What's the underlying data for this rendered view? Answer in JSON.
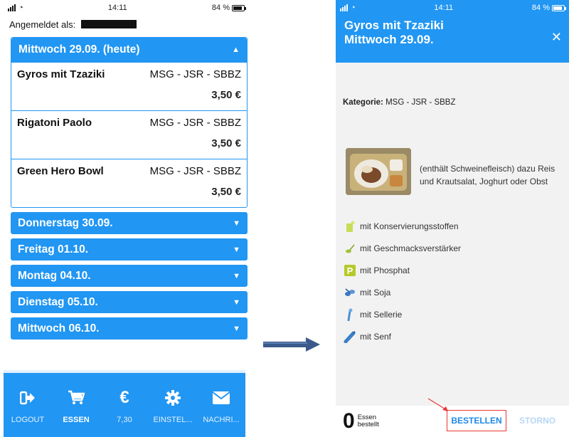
{
  "status": {
    "time": "14:11",
    "battery": "84 %"
  },
  "login": {
    "label": "Angemeldet als:"
  },
  "open_day": {
    "label": "Mittwoch 29.09.   (heute)",
    "meals": [
      {
        "name": "Gyros mit Tzaziki",
        "category": "MSG - JSR - SBBZ",
        "price": "3,50 €"
      },
      {
        "name": "Rigatoni Paolo",
        "category": "MSG - JSR - SBBZ",
        "price": "3,50 €"
      },
      {
        "name": "Green Hero Bowl",
        "category": "MSG - JSR - SBBZ",
        "price": "3,50 €"
      }
    ]
  },
  "days": [
    {
      "label": "Donnerstag 30.09."
    },
    {
      "label": "Freitag 01.10."
    },
    {
      "label": "Montag 04.10."
    },
    {
      "label": "Dienstag 05.10."
    },
    {
      "label": "Mittwoch 06.10."
    }
  ],
  "nav": [
    {
      "label": "LOGOUT",
      "icon": "logout-icon"
    },
    {
      "label": "ESSEN",
      "icon": "cart-icon",
      "active": true
    },
    {
      "label": "7,30",
      "icon": "euro-icon"
    },
    {
      "label": "EINSTEL...",
      "icon": "gear-icon"
    },
    {
      "label": "NACHRI...",
      "icon": "envelope-icon"
    }
  ],
  "detail": {
    "title_line1": "Gyros mit Tzaziki",
    "title_line2": "Mittwoch 29.09.",
    "category_label": "Kategorie:",
    "category_value": "MSG - JSR - SBBZ",
    "description": "(enthält Schweinefleisch) dazu Reis und Krautsalat, Joghurt oder Obst",
    "additives": [
      {
        "label": "mit Konservierungsstoffen",
        "icon": "preservative-icon"
      },
      {
        "label": "mit Geschmacksverstärker",
        "icon": "flavor-enhancer-icon"
      },
      {
        "label": "mit Phosphat",
        "icon": "phosphate-icon"
      },
      {
        "label": "mit Soja",
        "icon": "soy-icon"
      },
      {
        "label": "mit Sellerie",
        "icon": "celery-icon"
      },
      {
        "label": "mit Senf",
        "icon": "mustard-icon"
      }
    ],
    "count": "0",
    "count_label_1": "Essen",
    "count_label_2": "bestellt",
    "order_button": "BESTELLEN",
    "storno_button": "STORNO"
  },
  "colors": {
    "primary": "#2196f3",
    "highlight": "#e53935",
    "arrow": "#3a5a8c"
  }
}
